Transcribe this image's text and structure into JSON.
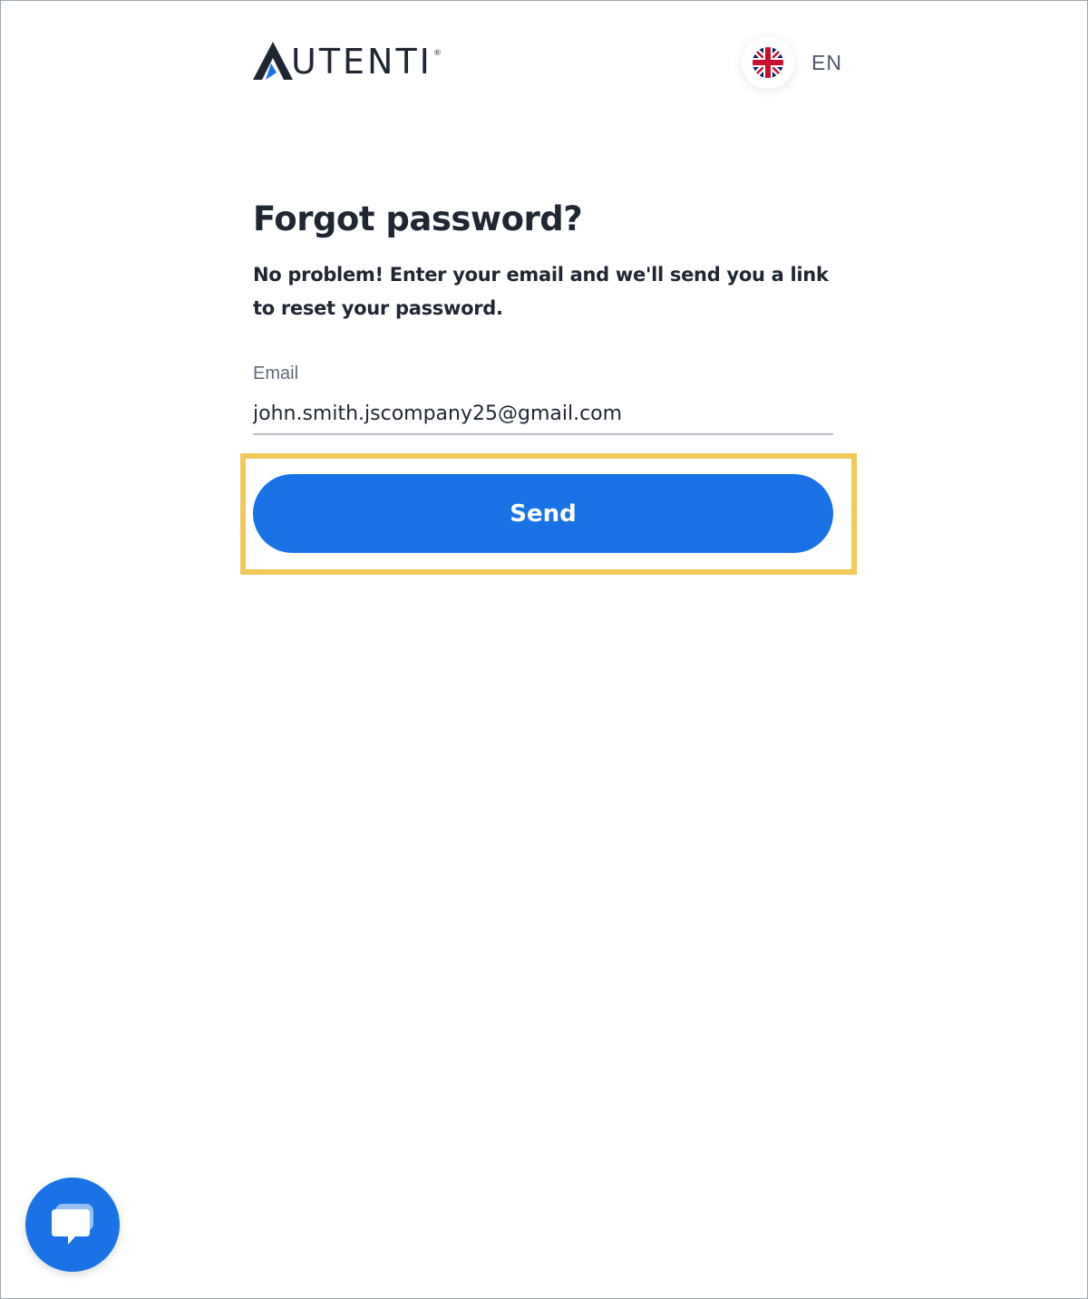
{
  "header": {
    "logo_text": "AUTENTI",
    "logo_registered": "®",
    "language": {
      "code": "EN",
      "flag_icon": "uk-flag-icon"
    }
  },
  "form": {
    "title": "Forgot password?",
    "subtitle": "No problem! Enter your email and we'll send you a link to reset your password.",
    "email": {
      "label": "Email",
      "value": "john.smith.jscompany25@gmail.com"
    },
    "send_label": "Send"
  },
  "chat": {
    "icon": "chat-bubble-icon"
  },
  "colors": {
    "primary": "#1a73e6",
    "text": "#1f2733",
    "highlight": "#f2c85b",
    "logo_accent": "#1a73e6"
  }
}
